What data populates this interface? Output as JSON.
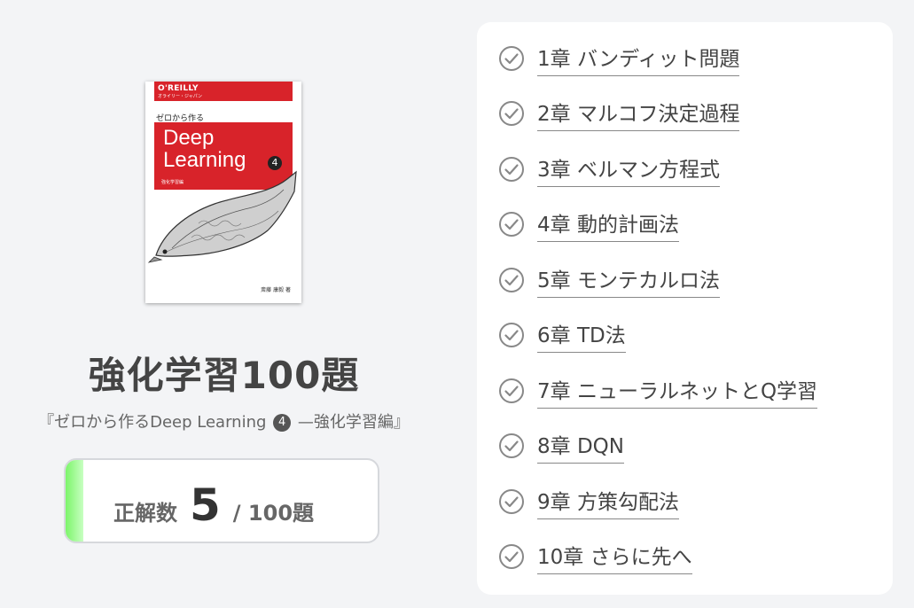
{
  "cover": {
    "publisher": "O'REILLY",
    "publisher_jp": "オライリー・ジャパン",
    "subtitle_jp": "ゼロから作る",
    "title_line1": "Deep",
    "title_line2": "Learning",
    "volume": "4",
    "series": "強化学習編",
    "author": "斎藤 康毅 著"
  },
  "title": "強化学習100題",
  "book_name_prefix": "『ゼロから作るDeep Learning",
  "book_name_volume": "4",
  "book_name_suffix": "—強化学習編』",
  "score": {
    "label": "正解数",
    "value": "5",
    "total": "/ 100題",
    "progress_fraction": 0.05
  },
  "chapters": [
    {
      "label": "1章 バンディット問題",
      "icon": "check-circle-icon"
    },
    {
      "label": "2章 マルコフ決定過程",
      "icon": "check-circle-icon"
    },
    {
      "label": "3章 ベルマン方程式",
      "icon": "check-circle-icon"
    },
    {
      "label": "4章 動的計画法",
      "icon": "check-circle-icon"
    },
    {
      "label": "5章 モンテカルロ法",
      "icon": "check-circle-icon"
    },
    {
      "label": "6章 TD法",
      "icon": "check-circle-icon"
    },
    {
      "label": "7章 ニューラルネットとQ学習",
      "icon": "check-circle-icon"
    },
    {
      "label": "8章 DQN",
      "icon": "check-circle-icon"
    },
    {
      "label": "9章 方策勾配法",
      "icon": "check-circle-icon"
    },
    {
      "label": "10章 さらに先へ",
      "icon": "check-circle-icon"
    }
  ],
  "colors": {
    "accent_red": "#d8232a",
    "progress_green": "#7cf56a",
    "check_gray": "#888888"
  }
}
